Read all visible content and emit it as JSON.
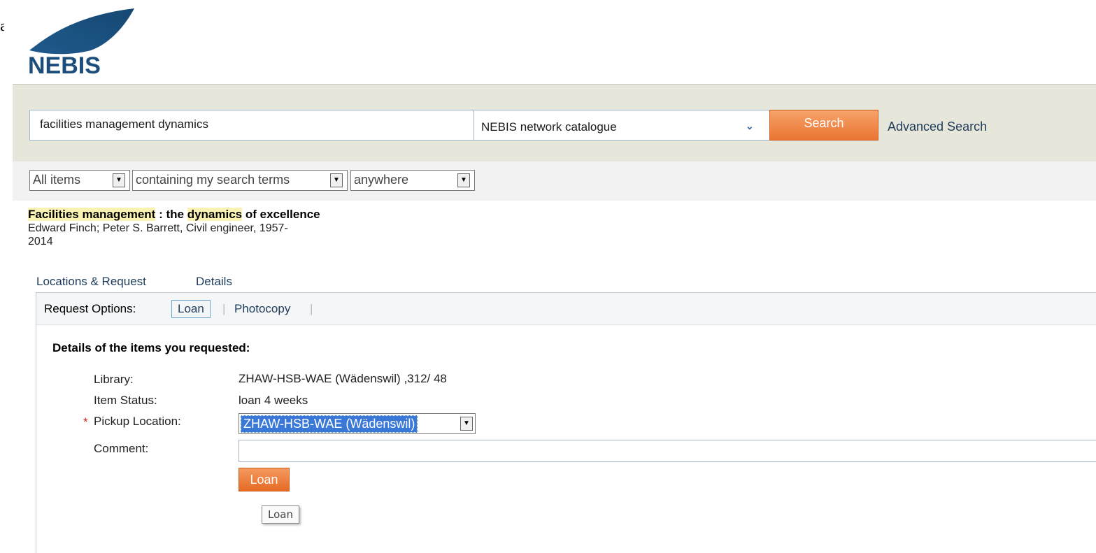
{
  "stray_char": "a",
  "logo": {
    "text": "NEBIS"
  },
  "search": {
    "query": "facilities management dynamics",
    "scope": "NEBIS network catalogue",
    "button": "Search",
    "advanced": "Advanced Search"
  },
  "filters": {
    "item_type": "All items",
    "match": "containing my search terms",
    "field": "anywhere"
  },
  "record": {
    "title_part1": "Facilities management",
    "title_part2": " : the ",
    "title_part3": "dynamics",
    "title_part4": " of excellence",
    "authors": "Edward Finch; Peter S. Barrett, Civil engineer, 1957-",
    "year": "2014"
  },
  "tabs": [
    "Locations & Request",
    "Details"
  ],
  "request_options": {
    "label": "Request Options:",
    "loan": "Loan",
    "separator": "|",
    "photocopy": "Photocopy"
  },
  "form": {
    "heading": "Details of the items you requested:",
    "library_label": "Library:",
    "library_value": "ZHAW-HSB-WAE (Wädenswil) ,312/ 48",
    "status_label": "Item Status:",
    "status_value": "loan 4 weeks",
    "required_marker": "*",
    "pickup_label": "Pickup Location:",
    "pickup_value": "ZHAW-HSB-WAE (Wädenswil)",
    "comment_label": "Comment:",
    "comment_value": "",
    "submit": "Loan",
    "tooltip": "Loan"
  },
  "colors": {
    "accent_orange": "#ea7431",
    "link_blue": "#1e3c5a",
    "logo_blue": "#1d4d7a",
    "search_band": "#e6e6da"
  },
  "icons": [
    "nebis-logo",
    "chevron-down-icon",
    "dropdown-arrow-icon"
  ]
}
